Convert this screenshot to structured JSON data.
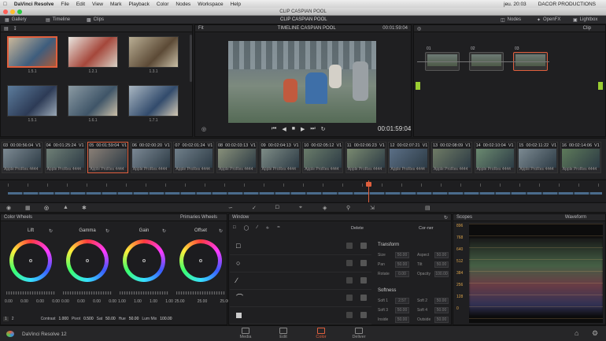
{
  "menubar": {
    "app": "DaVinci Resolve",
    "items": [
      "File",
      "Edit",
      "View",
      "Mark",
      "Playback",
      "Color",
      "Nodes",
      "Workspace",
      "Help"
    ],
    "right": [
      "jeu. 20:03",
      "DACOR PRODUCTIONS"
    ]
  },
  "window": {
    "title": "CLIP CASPIAN POOL"
  },
  "toolbar": {
    "gallery": "Gallery",
    "timeline": "Timeline",
    "clips": "Clips",
    "center_title": "CLIP CASPIAN POOL",
    "nodes": "Nodes",
    "openfx": "OpenFX",
    "lightbox": "Lightbox"
  },
  "gallery": {
    "stills": [
      {
        "label": "1.5.1"
      },
      {
        "label": "1.2.1"
      },
      {
        "label": "1.3.1"
      },
      {
        "label": "1.5.1"
      },
      {
        "label": "1.6.1"
      },
      {
        "label": "1.7.1"
      }
    ]
  },
  "viewer": {
    "fit": "Fit",
    "title": "TIMELINE CASPIAN POOL",
    "timecode_top": "00:01:59:04",
    "timecode": "00:01:59:04"
  },
  "nodes": {
    "mode": "Clip",
    "labels": [
      "01",
      "02",
      "03"
    ]
  },
  "clips": [
    {
      "num": "03",
      "tc": "00:00:56:04",
      "track": "V1",
      "fmt": "Apple ProRes 4444"
    },
    {
      "num": "04",
      "tc": "00:01:25:24",
      "track": "V1",
      "fmt": "Apple ProRes 4444"
    },
    {
      "num": "05",
      "tc": "00:01:59:04",
      "track": "V1",
      "fmt": "Apple ProRes 4444"
    },
    {
      "num": "06",
      "tc": "00:02:00:20",
      "track": "V1",
      "fmt": "Apple ProRes 4444"
    },
    {
      "num": "07",
      "tc": "00:02:01:24",
      "track": "V1",
      "fmt": "Apple ProRes 4444"
    },
    {
      "num": "08",
      "tc": "00:02:03:13",
      "track": "V1",
      "fmt": "Apple ProRes 4444"
    },
    {
      "num": "09",
      "tc": "00:02:04:13",
      "track": "V1",
      "fmt": "Apple ProRes 4444"
    },
    {
      "num": "10",
      "tc": "00:02:05:12",
      "track": "V1",
      "fmt": "Apple ProRes 4444"
    },
    {
      "num": "11",
      "tc": "00:02:06:23",
      "track": "V1",
      "fmt": "Apple ProRes 4444"
    },
    {
      "num": "12",
      "tc": "00:02:07:21",
      "track": "V1",
      "fmt": "Apple ProRes 4444"
    },
    {
      "num": "13",
      "tc": "00:02:08:09",
      "track": "V1",
      "fmt": "Apple ProRes 4444"
    },
    {
      "num": "14",
      "tc": "00:02:10:04",
      "track": "V1",
      "fmt": "Apple ProRes 4444"
    },
    {
      "num": "15",
      "tc": "00:02:11:22",
      "track": "V1",
      "fmt": "Apple ProRes 4444"
    },
    {
      "num": "16",
      "tc": "00:02:14:06",
      "track": "V1",
      "fmt": "Apple ProRes 4444"
    }
  ],
  "color_wheels": {
    "title": "Color Wheels",
    "mode": "Primaries Wheels",
    "wheels": [
      {
        "name": "Lift",
        "vals": [
          "0.00",
          "0.00",
          "0.00",
          "0.00"
        ]
      },
      {
        "name": "Gamma",
        "vals": [
          "0.00",
          "0.00",
          "0.00",
          "0.00"
        ]
      },
      {
        "name": "Gain",
        "vals": [
          "1.00",
          "1.00",
          "1.00",
          "1.00"
        ]
      },
      {
        "name": "Offset",
        "vals": [
          "25.00",
          "25.00",
          "25.00"
        ]
      }
    ],
    "contrast_label": "Contrast",
    "contrast": "1.000",
    "pivot_label": "Pivot",
    "pivot": "0.500",
    "sat_label": "Sat",
    "sat": "50.00",
    "hue_label": "Hue",
    "hue": "50.00",
    "lummix_label": "Lum Mix",
    "lummix": "100.00",
    "page_a": "1",
    "page_b": "2"
  },
  "window_panel": {
    "title": "Window",
    "delete": "Delete",
    "shapes": [
      "square",
      "circle",
      "line",
      "curve",
      "gradient"
    ]
  },
  "transform": {
    "title": "Transform",
    "corner": "Cor-ner",
    "fields": [
      {
        "l": "Size",
        "v": "50.00"
      },
      {
        "l": "Aspect",
        "v": "50.00"
      },
      {
        "l": "Pan",
        "v": "50.00"
      },
      {
        "l": "Tilt",
        "v": "50.00"
      },
      {
        "l": "Rotate",
        "v": "0.00"
      },
      {
        "l": "Opacity",
        "v": "100.00"
      }
    ]
  },
  "softness": {
    "title": "Softness",
    "fields": [
      {
        "l": "Soft 1",
        "v": "2.57"
      },
      {
        "l": "Soft 2",
        "v": "50.00"
      },
      {
        "l": "Soft 3",
        "v": "50.00"
      },
      {
        "l": "Soft 4",
        "v": "50.00"
      },
      {
        "l": "Inside",
        "v": "50.00"
      },
      {
        "l": "Outside",
        "v": "50.00"
      }
    ]
  },
  "scopes": {
    "title": "Scopes",
    "mode": "Waveform",
    "scale": [
      "896",
      "768",
      "640",
      "512",
      "384",
      "256",
      "128",
      "0"
    ]
  },
  "pagebar": {
    "app": "DaVinci Resolve 12",
    "pages": [
      "Media",
      "Edit",
      "Color",
      "Deliver"
    ]
  },
  "colors": {
    "accent": "#e05f3d",
    "bg": "#1b1b1d"
  }
}
